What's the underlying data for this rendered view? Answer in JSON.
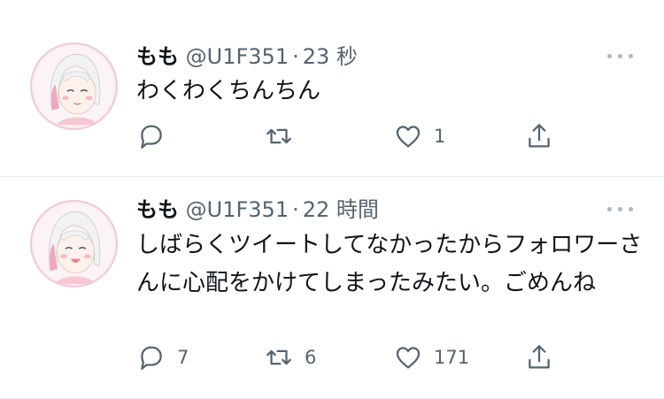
{
  "colors": {
    "text": "#0f1419",
    "secondary": "#536471",
    "icon": "#536471",
    "divider": "#e6ecf0"
  },
  "tweets": [
    {
      "name": "もも",
      "handle": "@U1F351",
      "separator": "·",
      "time": "23 秒",
      "text": "わくわくちんちん",
      "actions": {
        "reply_count": "",
        "retweet_count": "",
        "like_count": "1"
      },
      "icons": [
        "reply-icon",
        "retweet-icon",
        "like-icon",
        "share-icon",
        "more-icon"
      ]
    },
    {
      "name": "もも",
      "handle": "@U1F351",
      "separator": "·",
      "time": "22 時間",
      "text": "しばらくツイートしてなかったからフォロワーさんに心配をかけてしまったみたい。ごめんね",
      "actions": {
        "reply_count": "7",
        "retweet_count": "6",
        "like_count": "171"
      },
      "icons": [
        "reply-icon",
        "retweet-icon",
        "like-icon",
        "share-icon",
        "more-icon"
      ]
    }
  ]
}
